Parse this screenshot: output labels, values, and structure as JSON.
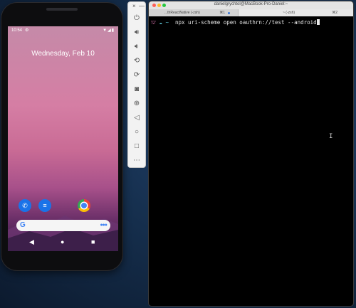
{
  "phone": {
    "status_time": "10:54",
    "date_widget": "Wednesday, Feb 10",
    "dock_apps": [
      "Phone",
      "Messages",
      "Chrome"
    ],
    "search_logo": "G",
    "nav": {
      "back": "◀",
      "home": "●",
      "recents": "■"
    },
    "colors": {
      "wallpaper_top": "#d57ea4",
      "wallpaper_bottom": "#3a1e46"
    }
  },
  "emulator_toolbar": {
    "close": "×",
    "minimize": "—",
    "buttons": [
      "power-icon",
      "volume-up-icon",
      "volume-down-icon",
      "rotate-left-icon",
      "rotate-right-icon",
      "camera-icon",
      "zoom-icon",
      "back-icon",
      "home-icon",
      "overview-icon",
      "more-icon"
    ]
  },
  "terminal": {
    "window_title": "danielgrychtol@MacBook-Pro-Daniel:~",
    "tabs": [
      {
        "label": "...thReactNative (-zsh)",
        "shortcut": "⌘1"
      },
      {
        "label": "~ (-zsh)",
        "shortcut": "⌘2"
      }
    ],
    "prompt_symbol": "~",
    "command": "npx uri-scheme open oauthrn://test --android"
  }
}
